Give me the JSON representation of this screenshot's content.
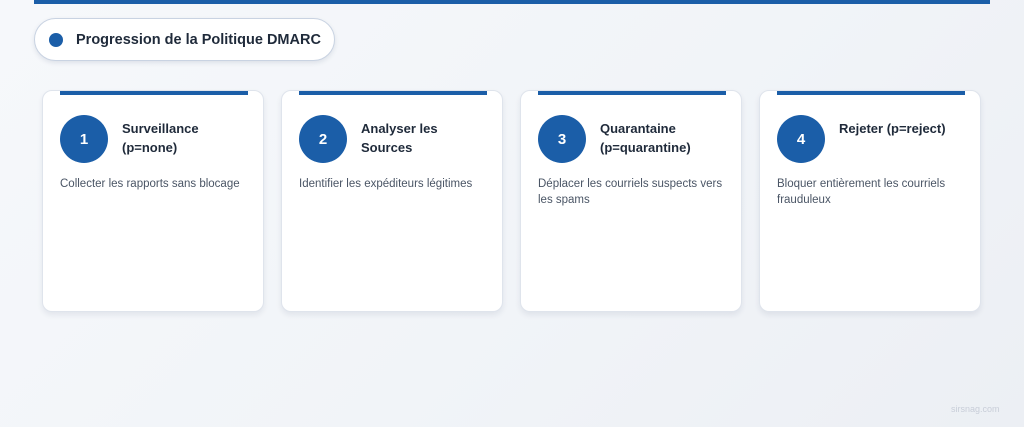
{
  "title": "Progression de la Politique DMARC",
  "steps": [
    {
      "number": "1",
      "title": "Surveillance (p=none)",
      "description": "Collecter les rapports sans blocage"
    },
    {
      "number": "2",
      "title": "Analyser les Sources",
      "description": "Identifier les expéditeurs légitimes"
    },
    {
      "number": "3",
      "title": "Quarantaine (p=quarantine)",
      "description": "Déplacer les courriels suspects vers les spams"
    },
    {
      "number": "4",
      "title": "Rejeter (p=reject)",
      "description": "Bloquer entièrement les courriels frauduleux"
    }
  ],
  "watermark": "sirsnag.com",
  "colors": {
    "accent": "#1b5ea8",
    "card_background": "#ffffff",
    "title_text": "#1f2a3a",
    "description_text": "#4a5565"
  }
}
